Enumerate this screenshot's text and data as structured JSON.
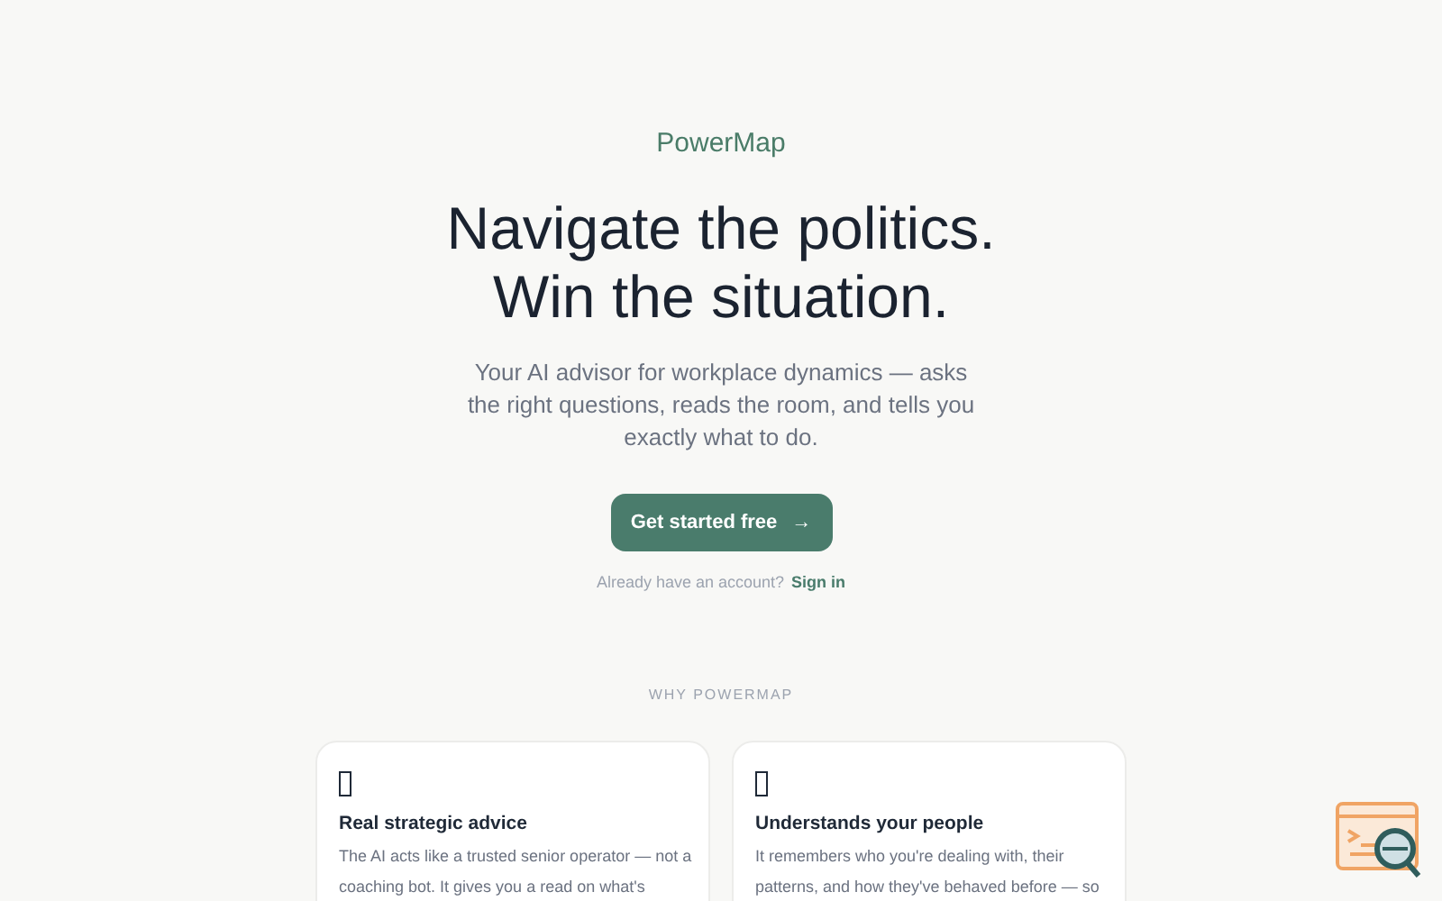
{
  "brand": "PowerMap",
  "headline": [
    "Navigate the politics.",
    "Win the situation."
  ],
  "subtitle": "Your AI advisor for workplace dynamics — asks the right questions, reads the room, and tells you exactly what to do.",
  "cta": {
    "label": "Get started free",
    "arrow": "→"
  },
  "signin": {
    "text": "Already have an account?",
    "link": "Sign in"
  },
  "section_label": "WHY POWERMAP",
  "features": [
    {
      "title": "Real strategic advice",
      "text": "The AI acts like a trusted senior operator — not a coaching bot. It gives you a read on what's"
    },
    {
      "title": "Understands your people",
      "text": "It remembers who you're dealing with, their patterns, and how they've behaved before — so"
    }
  ]
}
